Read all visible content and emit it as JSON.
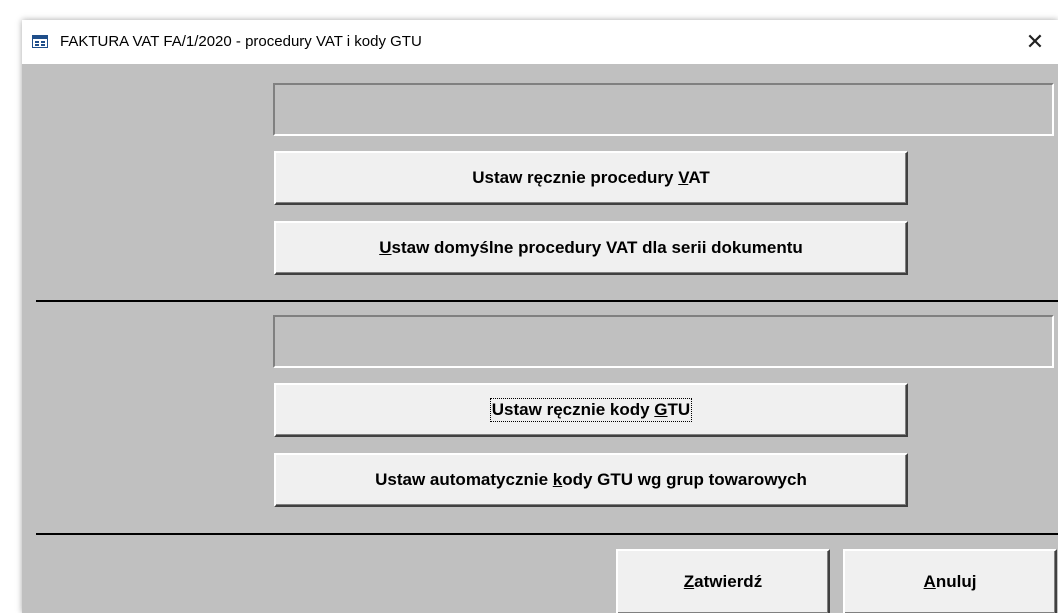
{
  "window": {
    "title": "FAKTURA VAT FA/1/2020 - procedury VAT i kody GTU",
    "close_glyph": "✕"
  },
  "vat_section": {
    "info_text": "",
    "manual_button": {
      "before": "Ustaw ręcznie procedury ",
      "key": "V",
      "after": "AT"
    },
    "default_button": {
      "before": "",
      "key": "U",
      "after": "staw domyślne procedury VAT dla serii dokumentu"
    }
  },
  "gtu_section": {
    "info_text": "",
    "manual_button": {
      "before": "Ustaw ręcznie kody ",
      "key": "G",
      "after": "TU"
    },
    "auto_button": {
      "before": "Ustaw automatycznie ",
      "key": "k",
      "after": "ody GTU wg grup towarowych"
    }
  },
  "footer": {
    "confirm_button": {
      "before": "",
      "key": "Z",
      "after": "atwierdź"
    },
    "cancel_button": {
      "before": "",
      "key": "A",
      "after": "nuluj"
    }
  },
  "colors": {
    "dialog_background": "#c0c0c0",
    "button_face": "#f0f0f0",
    "titlebar": "#ffffff"
  },
  "icons": {
    "app": "window-form-icon",
    "close": "close-icon"
  }
}
